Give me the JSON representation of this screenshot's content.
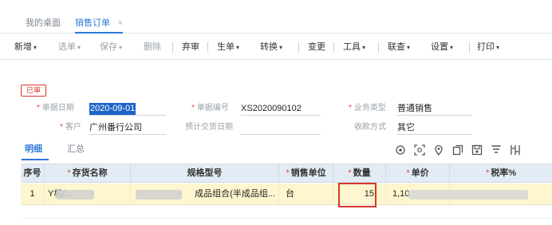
{
  "tabs": [
    {
      "label": "我的桌面"
    },
    {
      "label": "销售订单",
      "close": "×"
    }
  ],
  "toolbar": {
    "items": [
      {
        "label": "新增",
        "caret": "▾"
      },
      {
        "label": "选单",
        "caret": "▾"
      },
      {
        "label": "保存",
        "caret": "▾"
      },
      {
        "label": "删除"
      },
      {
        "label": "弃审"
      },
      {
        "label": "生单",
        "caret": "▾"
      },
      {
        "label": "转换",
        "caret": "▾"
      },
      {
        "label": "变更"
      },
      {
        "label": "工具",
        "caret": "▾"
      },
      {
        "label": "联查",
        "caret": "▾"
      },
      {
        "label": "设置",
        "caret": "▾"
      },
      {
        "label": "打印",
        "caret": "▾"
      }
    ]
  },
  "status_badge": "已审",
  "form": {
    "date_label": "单据日期",
    "date_value": "2020-09-01",
    "number_label": "单据编号",
    "number_value": "XS2020090102",
    "biztype_label": "业务类型",
    "biztype_value": "普通销售",
    "customer_label": "客户",
    "customer_value": "广州番行公司",
    "delivery_label": "预计交货日期",
    "payment_label": "收款方式",
    "payment_value": "其它"
  },
  "section_tabs": [
    "明细",
    "汇总"
  ],
  "grid": {
    "columns": [
      "序号",
      "存货名称",
      "规格型号",
      "销售单位",
      "数量",
      "单价",
      "税率%"
    ],
    "required": [
      "",
      "*",
      "",
      "*",
      "*",
      "*",
      "*"
    ],
    "rows": [
      {
        "seq": "1",
        "name": "Y机/...",
        "spec": "成品组合(半成品组...",
        "unit": "台",
        "qty": "15",
        "price": "1,10",
        "tax": ""
      }
    ]
  },
  "colors": {
    "accent": "#2c77d6",
    "highlight_red": "#d9372a",
    "header_bg": "#e3ebf4",
    "row_bg": "#fdf6cf",
    "selection": "#1e64c8"
  },
  "icons": [
    "location-target-icon",
    "scan-icon",
    "location-pin-icon",
    "copy-icon",
    "save-icon",
    "filter-icon",
    "column-settings-icon"
  ]
}
